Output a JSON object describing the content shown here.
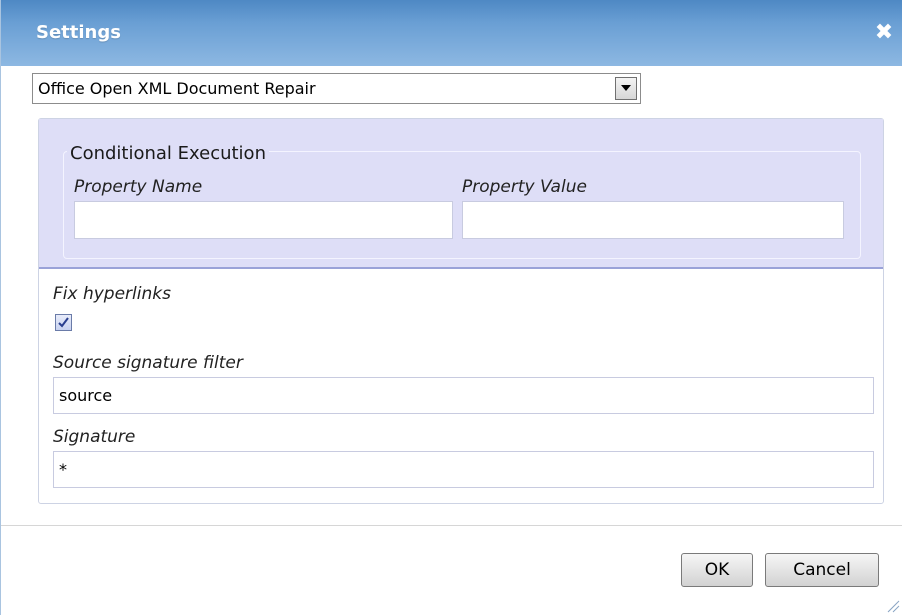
{
  "dialog": {
    "title": "Settings",
    "close_symbol": "✖"
  },
  "action_select": {
    "selected": "Office Open XML Document Repair"
  },
  "conditional_execution": {
    "legend": "Conditional Execution",
    "property_name_label": "Property Name",
    "property_name_value": "",
    "property_value_label": "Property Value",
    "property_value_value": ""
  },
  "fix_hyperlinks": {
    "label": "Fix hyperlinks",
    "checked": true
  },
  "source_signature_filter": {
    "label": "Source signature filter",
    "value": "source"
  },
  "signature": {
    "label": "Signature",
    "value": "*"
  },
  "buttons": {
    "ok": "OK",
    "cancel": "Cancel"
  },
  "colors": {
    "titlebar_top": "#4e88c4",
    "titlebar_bottom": "#8db8e2",
    "condition_background": "#dedef7",
    "condition_border": "#9aa2d8"
  },
  "icons": {
    "close": "close-icon",
    "dropdown": "chevron-down-icon",
    "checkbox": "checkmark-icon",
    "resize": "resize-grip-icon"
  }
}
